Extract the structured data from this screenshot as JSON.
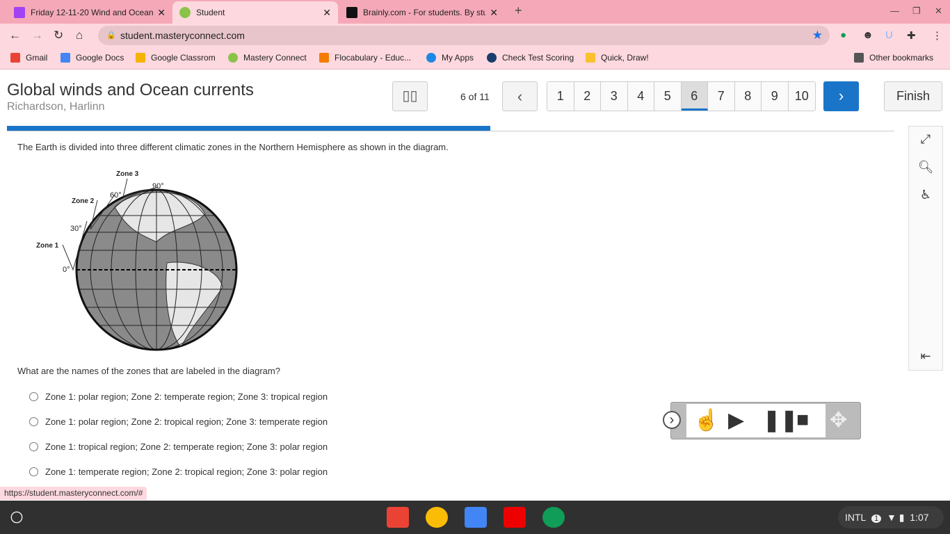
{
  "browser": {
    "tabs": [
      {
        "title": "Friday 12-11-20 Wind and Ocean"
      },
      {
        "title": "Student"
      },
      {
        "title": "Brainly.com - For students. By students."
      }
    ],
    "url": "student.masteryconnect.com",
    "bookmarks": [
      "Gmail",
      "Google Docs",
      "Google Classrom",
      "Mastery Connect",
      "Flocabulary - Educ...",
      "My Apps",
      "Check Test Scoring",
      "Quick, Draw!"
    ],
    "other_bookmarks": "Other bookmarks",
    "status_url": "https://student.masteryconnect.com/#"
  },
  "header": {
    "title": "Global winds and Ocean currents",
    "student": "Richardson, Harlinn",
    "count": "6 of 11",
    "pages": [
      "1",
      "2",
      "3",
      "4",
      "5",
      "6",
      "7",
      "8",
      "9",
      "10"
    ],
    "current_page": 6,
    "finish": "Finish"
  },
  "progress": {
    "fraction": 0.545
  },
  "question": {
    "intro": "The Earth is divided into three different climatic zones in the Northern Hemisphere as shown in the diagram.",
    "diagram_labels": {
      "zone1": "Zone 1",
      "zone2": "Zone 2",
      "zone3": "Zone 3",
      "d0": "0°",
      "d30": "30°",
      "d60": "60°",
      "d90": "90°"
    },
    "prompt": "What are the names of the zones that are labeled in the diagram?",
    "options": [
      "Zone 1: polar region; Zone 2: temperate region; Zone 3: tropical region",
      "Zone 1: polar region; Zone 2: tropical region; Zone 3: temperate region",
      "Zone 1: tropical region; Zone 2: temperate region; Zone 3: polar region",
      "Zone 1: temperate region; Zone 2: tropical region; Zone 3: polar region"
    ]
  },
  "tray": {
    "ime": "INTL",
    "notifications": "1",
    "time": "1:07"
  },
  "colors": {
    "accent": "#1a75c9",
    "tab_bar": "#f5a9b8",
    "toolbar": "#fdd8df"
  }
}
